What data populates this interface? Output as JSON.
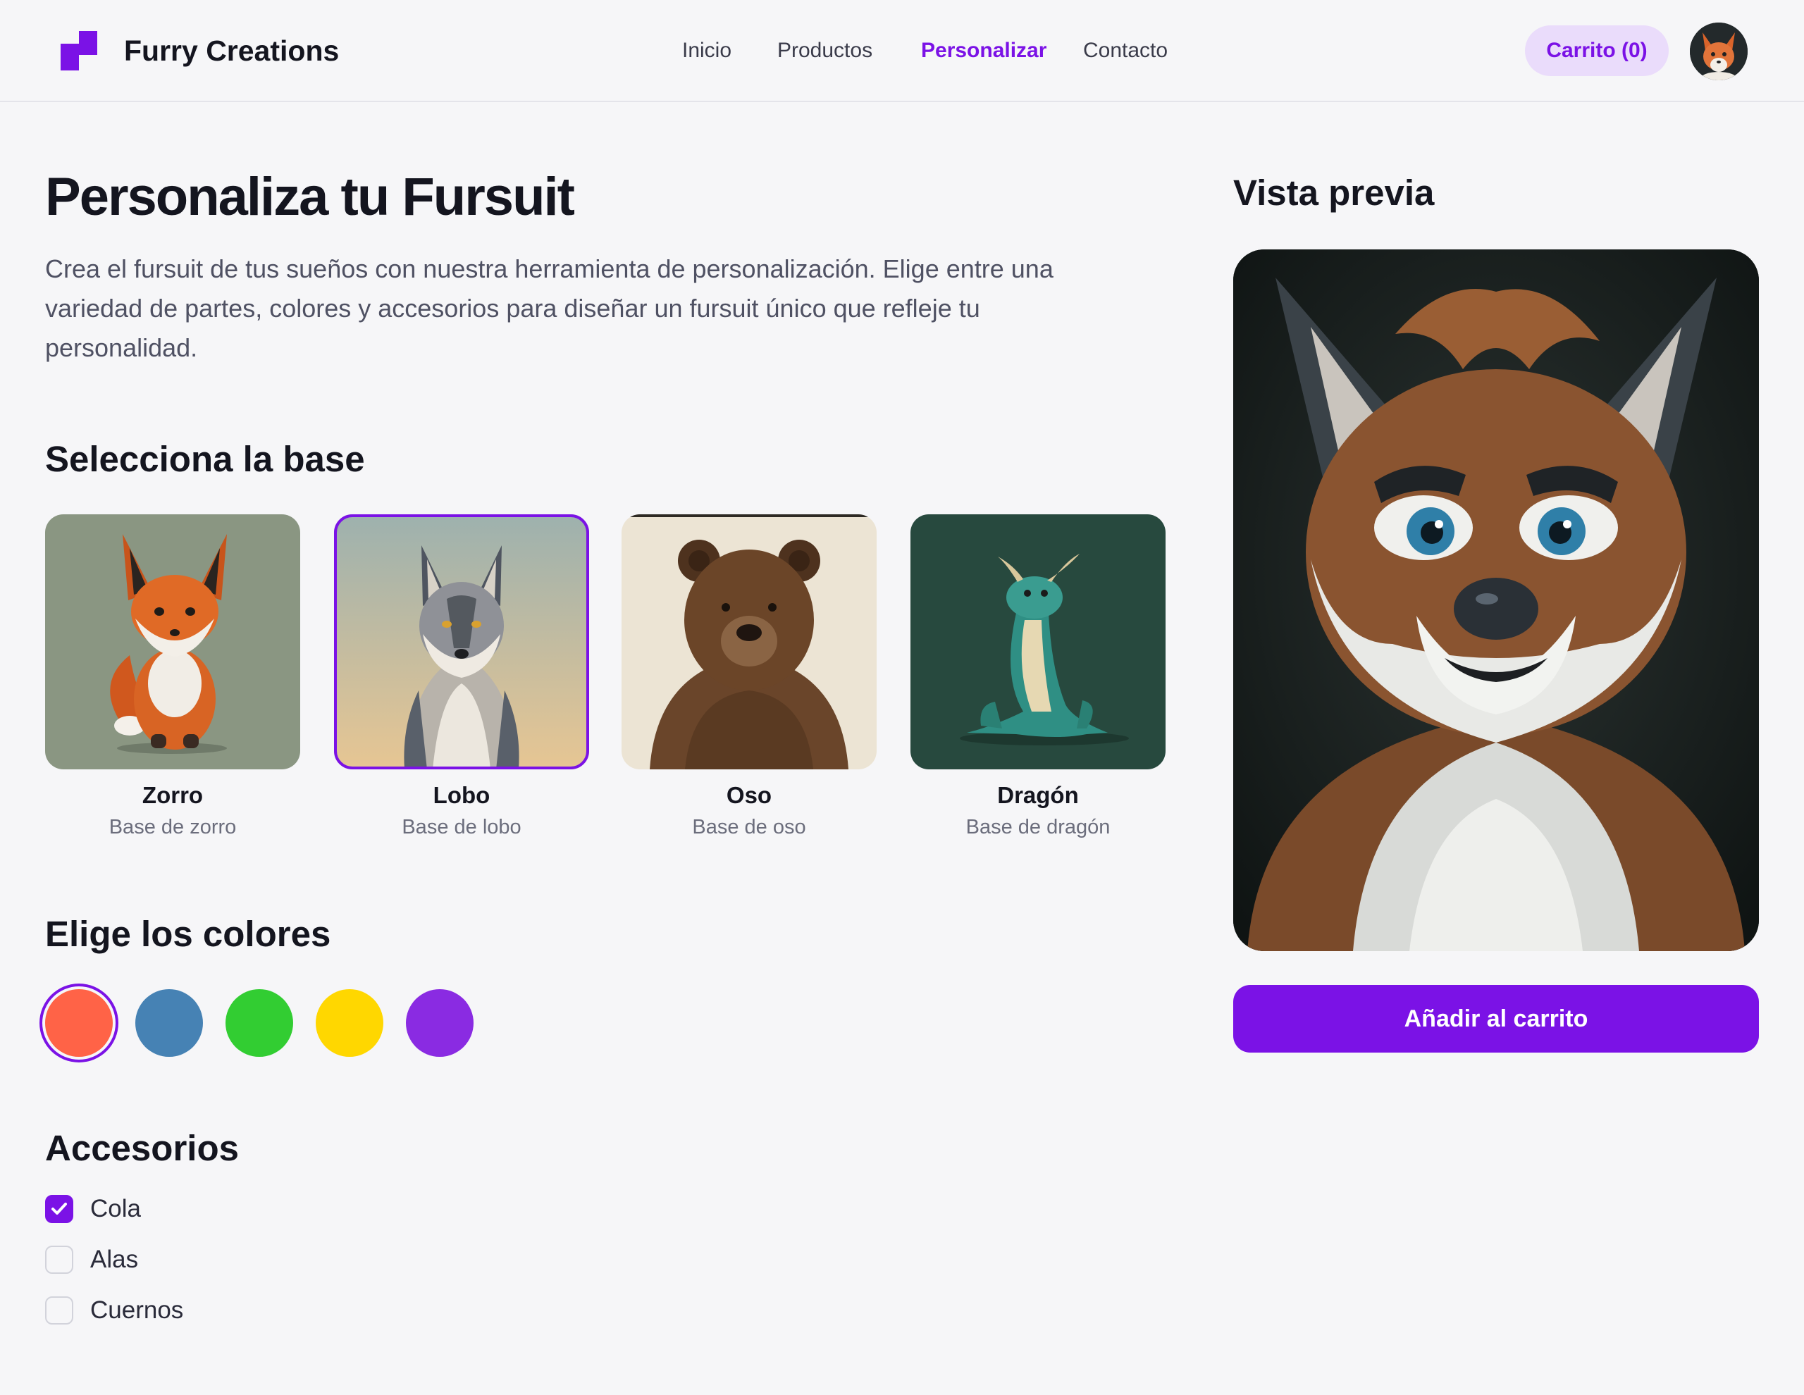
{
  "header": {
    "brand": "Furry Creations",
    "nav": [
      {
        "label": "Inicio",
        "active": false
      },
      {
        "label": "Productos",
        "active": false
      },
      {
        "label": "Personalizar",
        "active": true
      },
      {
        "label": "Contacto",
        "active": false
      }
    ],
    "cart_label": "Carrito (0)",
    "logo_icon": "brand-logo-icon",
    "accent_color": "#7b12e6"
  },
  "main": {
    "title": "Personaliza tu Fursuit",
    "description": "Crea el fursuit de tus sueños con nuestra herramienta de personalización. Elige entre una variedad de partes, colores y accesorios para diseñar un fursuit único que refleje tu personalidad.",
    "base_heading": "Selecciona la base",
    "bases": [
      {
        "name": "Zorro",
        "sub": "Base de zorro",
        "selected": false
      },
      {
        "name": "Lobo",
        "sub": "Base de lobo",
        "selected": true
      },
      {
        "name": "Oso",
        "sub": "Base de oso",
        "selected": false
      },
      {
        "name": "Dragón",
        "sub": "Base de dragón",
        "selected": false
      }
    ],
    "colors_heading": "Elige los colores",
    "colors": [
      {
        "hex": "#ff6347",
        "selected": true
      },
      {
        "hex": "#4682b4",
        "selected": false
      },
      {
        "hex": "#32cd32",
        "selected": false
      },
      {
        "hex": "#ffd700",
        "selected": false
      },
      {
        "hex": "#8a2be2",
        "selected": false
      }
    ],
    "accessories_heading": "Accesorios",
    "accessories": [
      {
        "label": "Cola",
        "checked": true
      },
      {
        "label": "Alas",
        "checked": false
      },
      {
        "label": "Cuernos",
        "checked": false
      }
    ]
  },
  "preview": {
    "title": "Vista previa",
    "add_to_cart": "Añadir al carrito"
  }
}
